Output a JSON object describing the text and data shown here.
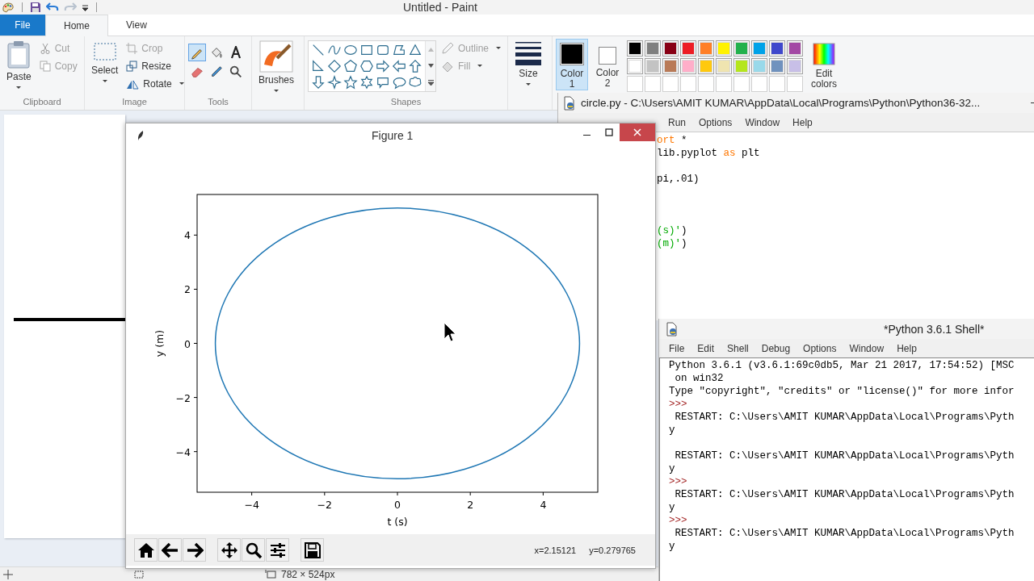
{
  "paint": {
    "title": "Untitled - Paint",
    "tabs": [
      {
        "label": "File",
        "kind": "file",
        "selected": false
      },
      {
        "label": "Home",
        "kind": "tab",
        "selected": true
      },
      {
        "label": "View",
        "kind": "tab",
        "selected": false
      }
    ],
    "clipboard": {
      "group": "Clipboard",
      "paste": "Paste",
      "items": [
        {
          "label": "Cut",
          "kind": "cut",
          "disabled": true
        },
        {
          "label": "Copy",
          "kind": "copy",
          "disabled": true
        }
      ]
    },
    "image": {
      "group": "Image",
      "select": "Select",
      "items": [
        {
          "label": "Crop",
          "kind": "crop",
          "disabled": true
        },
        {
          "label": "Resize",
          "kind": "resize",
          "disabled": false
        },
        {
          "label": "Rotate",
          "kind": "rotate",
          "disabled": false
        }
      ]
    },
    "tools": {
      "group": "Tools",
      "items": [
        {
          "kind": "pencil",
          "selected": true
        },
        {
          "kind": "fill",
          "selected": false
        },
        {
          "kind": "text",
          "selected": false
        },
        {
          "kind": "eraser",
          "selected": false
        },
        {
          "kind": "picker",
          "selected": false
        },
        {
          "kind": "magnifier",
          "selected": false
        }
      ]
    },
    "brushes": "Brushes",
    "shapes": {
      "group": "Shapes",
      "outline": {
        "label": "Outline",
        "disabled": true
      },
      "fill": {
        "label": "Fill",
        "disabled": true
      }
    },
    "size": "Size",
    "color_slots": [
      {
        "label": "Color 1",
        "color": "#000000",
        "selected": true
      },
      {
        "label": "Color 2",
        "color": "#ffffff",
        "selected": false
      }
    ],
    "palette": [
      {
        "color": "#000000"
      },
      {
        "color": "#7f7f7f"
      },
      {
        "color": "#880015"
      },
      {
        "color": "#ed1c24"
      },
      {
        "color": "#ff7f27"
      },
      {
        "color": "#fff200"
      },
      {
        "color": "#22b14c"
      },
      {
        "color": "#00a2e8"
      },
      {
        "color": "#3f48cc"
      },
      {
        "color": "#a349a4"
      },
      {
        "color": "#ffffff"
      },
      {
        "color": "#c3c3c3"
      },
      {
        "color": "#b97a57"
      },
      {
        "color": "#ffaec9"
      },
      {
        "color": "#ffc90e"
      },
      {
        "color": "#efe4b0"
      },
      {
        "color": "#b5e61d"
      },
      {
        "color": "#99d9ea"
      },
      {
        "color": "#7092be"
      },
      {
        "color": "#c8bfe7"
      }
    ],
    "edit_colors": "Edit colors",
    "status_bar": {
      "size": "782 × 524px"
    }
  },
  "editor": {
    "title": "circle.py - C:\\Users\\AMIT KUMAR\\AppData\\Local\\Programs\\Python\\Python36-32...",
    "menu": [
      "Run",
      "Options",
      "Window",
      "Help"
    ],
    "lines": [
      {
        "kind": "code",
        "tokens": [
          {
            "text": "ort",
            "kind": "keyword"
          },
          {
            "text": " *",
            "kind": "plain"
          }
        ]
      },
      {
        "kind": "code",
        "tokens": [
          {
            "text": "lib.pyplot ",
            "kind": "plain"
          },
          {
            "text": "as",
            "kind": "keyword"
          },
          {
            "text": " plt",
            "kind": "plain"
          }
        ]
      },
      {
        "kind": "blank"
      },
      {
        "kind": "code",
        "tokens": [
          {
            "text": "pi,.01)",
            "kind": "plain"
          }
        ]
      },
      {
        "kind": "blank"
      },
      {
        "kind": "blank"
      },
      {
        "kind": "blank"
      },
      {
        "kind": "code",
        "tokens": [
          {
            "text": "(s)'",
            "kind": "string"
          },
          {
            "text": ")",
            "kind": "plain"
          }
        ]
      },
      {
        "kind": "code",
        "tokens": [
          {
            "text": "(m)'",
            "kind": "string"
          },
          {
            "text": ")",
            "kind": "plain"
          }
        ]
      }
    ]
  },
  "figure": {
    "title": "Figure 1",
    "chart_data": {
      "type": "line",
      "xlabel": "t (s)",
      "ylabel": "y (m)",
      "xlim": [
        -5.5,
        5.5
      ],
      "ylim": [
        -5.5,
        5.5
      ],
      "xticks": [
        {
          "value": -4,
          "label": "−4"
        },
        {
          "value": -2,
          "label": "−2"
        },
        {
          "value": 0,
          "label": "0"
        },
        {
          "value": 2,
          "label": "2"
        },
        {
          "value": 4,
          "label": "4"
        }
      ],
      "yticks": [
        {
          "value": -4,
          "label": "−4"
        },
        {
          "value": -2,
          "label": "−2"
        },
        {
          "value": 0,
          "label": "0"
        },
        {
          "value": 2,
          "label": "2"
        },
        {
          "value": 4,
          "label": "4"
        }
      ]
    },
    "coords": {
      "x": "x=2.15121",
      "y": "y=0.279765"
    }
  },
  "shell": {
    "title": "*Python 3.6.1 Shell*",
    "menu": [
      "File",
      "Edit",
      "Shell",
      "Debug",
      "Options",
      "Window",
      "Help"
    ],
    "lines": [
      {
        "kind": "output",
        "text": "Python 3.6.1 (v3.6.1:69c0db5, Mar 21 2017, 17:54:52) [MSC"
      },
      {
        "kind": "output",
        "text": " on win32"
      },
      {
        "kind": "output",
        "text": "Type \"copyright\", \"credits\" or \"license()\" for more infor"
      },
      {
        "kind": "prompt",
        "text": ">>>"
      },
      {
        "kind": "output",
        "text": " RESTART: C:\\Users\\AMIT KUMAR\\AppData\\Local\\Programs\\Pyth"
      },
      {
        "kind": "output",
        "text": "y"
      },
      {
        "kind": "blank"
      },
      {
        "kind": "output",
        "text": " RESTART: C:\\Users\\AMIT KUMAR\\AppData\\Local\\Programs\\Pyth"
      },
      {
        "kind": "output",
        "text": "y"
      },
      {
        "kind": "prompt",
        "text": ">>>"
      },
      {
        "kind": "output",
        "text": " RESTART: C:\\Users\\AMIT KUMAR\\AppData\\Local\\Programs\\Pyth"
      },
      {
        "kind": "output",
        "text": "y"
      },
      {
        "kind": "prompt",
        "text": ">>>"
      },
      {
        "kind": "output",
        "text": " RESTART: C:\\Users\\AMIT KUMAR\\AppData\\Local\\Programs\\Pyth"
      },
      {
        "kind": "output",
        "text": "y"
      }
    ]
  }
}
